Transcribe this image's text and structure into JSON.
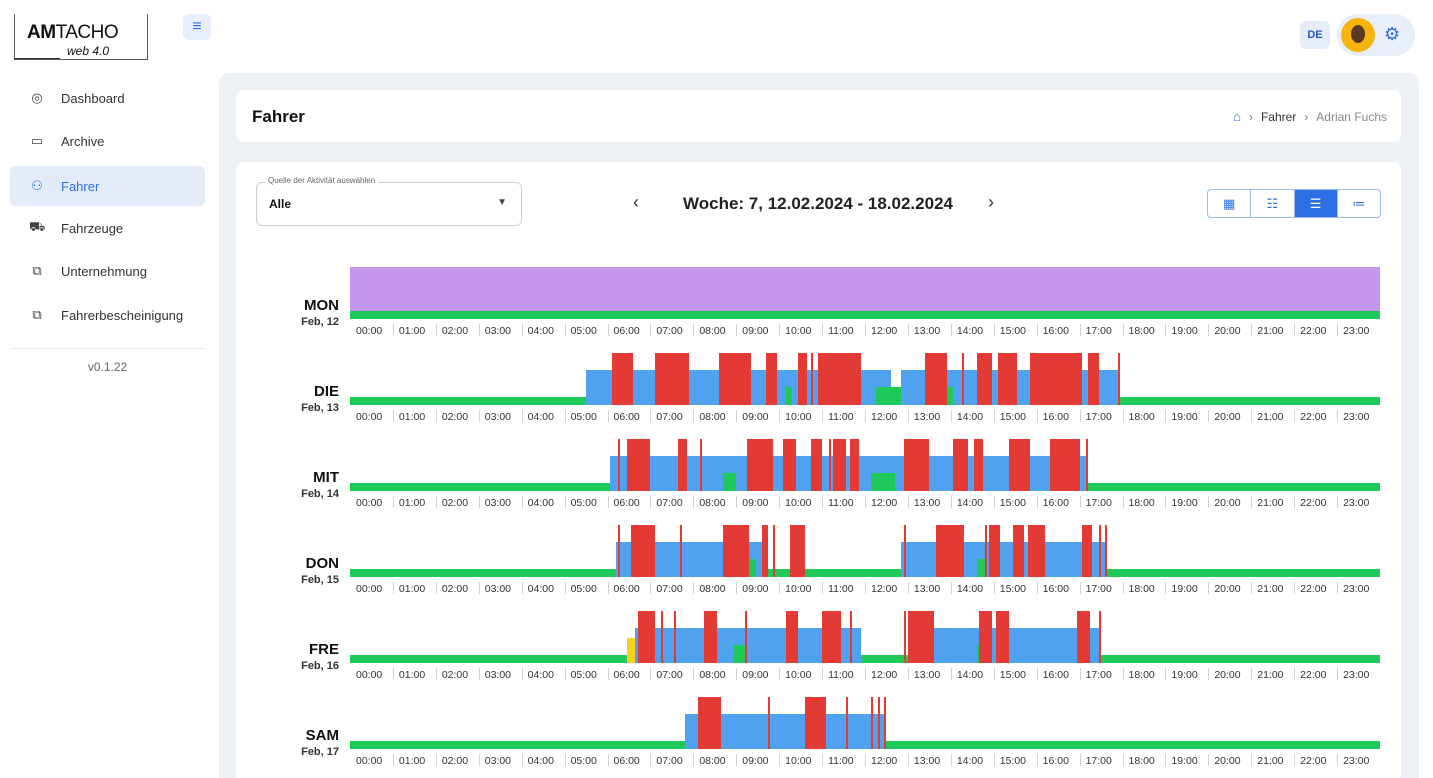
{
  "app": {
    "logo_am": "AM",
    "logo_tacho": "TACHO",
    "logo_sub": "web 4.0",
    "language": "DE"
  },
  "sidebar": {
    "items": [
      {
        "label": "Dashboard",
        "icon": "dashboard-icon"
      },
      {
        "label": "Archive",
        "icon": "archive-icon"
      },
      {
        "label": "Fahrer",
        "icon": "users-icon",
        "active": true
      },
      {
        "label": "Fahrzeuge",
        "icon": "truck-icon"
      },
      {
        "label": "Unternehmung",
        "icon": "building-icon"
      },
      {
        "label": "Fahrerbescheinigung",
        "icon": "certificate-icon"
      }
    ],
    "version": "v0.1.22"
  },
  "header": {
    "title": "Fahrer",
    "breadcrumb": {
      "item1": "Fahrer",
      "item2": "Adrian Fuchs"
    }
  },
  "filter": {
    "label": "Quelle der Aktivität auswählen",
    "value": "Alle"
  },
  "week": {
    "label": "Woche: 7, 12.02.2024 - 18.02.2024"
  },
  "colors": {
    "rest": "#1ec95a",
    "available": "#4fa3ee",
    "work": "#4fa3ee",
    "drive": "#e43a35",
    "unknown": "#c696ef",
    "ferry": "#f4d21c",
    "accent": "#2f6fe4"
  },
  "hours": [
    "00:00",
    "01:00",
    "02:00",
    "03:00",
    "04:00",
    "05:00",
    "06:00",
    "07:00",
    "08:00",
    "09:00",
    "10:00",
    "11:00",
    "12:00",
    "13:00",
    "14:00",
    "15:00",
    "16:00",
    "17:00",
    "18:00",
    "19:00",
    "20:00",
    "21:00",
    "22:00",
    "23:00"
  ],
  "days": [
    {
      "name": "MON",
      "date": "Feb, 12",
      "unknown": [
        0,
        24
      ]
    },
    {
      "name": "DIE",
      "date": "Feb, 13",
      "work": [
        [
          5.5,
          12.6
        ],
        [
          12.85,
          17.95
        ]
      ],
      "rest_gaps": [
        [
          10.15,
          10.3
        ],
        [
          12.25,
          12.85
        ],
        [
          13.5,
          14.05
        ]
      ],
      "drive": [
        [
          6.1,
          6.6
        ],
        [
          7.1,
          7.9
        ],
        [
          8.6,
          9.35
        ],
        [
          9.7,
          9.95
        ],
        [
          10.45,
          10.65
        ],
        [
          10.9,
          11.9
        ],
        [
          13.4,
          13.9
        ],
        [
          14.6,
          14.95
        ],
        [
          15.1,
          15.55
        ],
        [
          15.85,
          17.05
        ],
        [
          17.2,
          17.45
        ]
      ],
      "thin": [
        [
          9.2
        ],
        [
          10.75
        ],
        [
          14.25
        ],
        [
          17.9
        ]
      ]
    },
    {
      "name": "MIT",
      "date": "Feb, 14",
      "work": [
        [
          6.05,
          17.2
        ]
      ],
      "rest_gaps": [
        [
          8.7,
          9.0
        ],
        [
          12.15,
          12.7
        ]
      ],
      "drive": [
        [
          6.45,
          7.0
        ],
        [
          7.65,
          7.85
        ],
        [
          9.25,
          9.85
        ],
        [
          10.1,
          10.4
        ],
        [
          10.75,
          11.0
        ],
        [
          11.25,
          11.55
        ],
        [
          11.65,
          11.85
        ],
        [
          12.9,
          13.5
        ],
        [
          14.05,
          14.4
        ],
        [
          14.55,
          14.75
        ],
        [
          15.35,
          15.85
        ],
        [
          16.3,
          17.0
        ]
      ],
      "thin": [
        [
          6.25
        ],
        [
          8.15
        ],
        [
          11.15
        ],
        [
          17.15
        ]
      ]
    },
    {
      "name": "DON",
      "date": "Feb, 15",
      "work": [
        [
          6.2,
          9.65
        ],
        [
          12.85,
          17.6
        ]
      ],
      "rest_gaps": [
        [
          9.0,
          9.45
        ],
        [
          14.6,
          14.8
        ]
      ],
      "drive": [
        [
          6.55,
          7.1
        ],
        [
          8.7,
          9.3
        ],
        [
          9.6,
          9.75
        ],
        [
          10.25,
          10.6
        ],
        [
          13.65,
          14.3
        ],
        [
          14.9,
          15.15
        ],
        [
          15.45,
          15.7
        ],
        [
          15.8,
          16.2
        ],
        [
          17.05,
          17.3
        ]
      ],
      "thin": [
        [
          6.25
        ],
        [
          7.7
        ],
        [
          9.85
        ],
        [
          12.9
        ],
        [
          14.8
        ],
        [
          17.45
        ],
        [
          17.6
        ]
      ]
    },
    {
      "name": "FRE",
      "date": "Feb, 16",
      "work": [
        [
          6.65,
          11.9
        ],
        [
          13.0,
          17.5
        ]
      ],
      "rest_gaps": [
        [
          8.95,
          9.25
        ],
        [
          14.6,
          14.95
        ]
      ],
      "ferry": [
        [
          6.45,
          6.65
        ]
      ],
      "drive": [
        [
          6.75,
          7.1
        ],
        [
          8.25,
          8.55
        ],
        [
          10.15,
          10.45
        ],
        [
          11.0,
          11.45
        ],
        [
          13.0,
          13.6
        ],
        [
          14.65,
          14.95
        ],
        [
          15.05,
          15.35
        ],
        [
          16.95,
          17.25
        ]
      ],
      "thin": [
        [
          6.7
        ],
        [
          7.25
        ],
        [
          7.55
        ],
        [
          9.2
        ],
        [
          11.65
        ],
        [
          12.9
        ],
        [
          17.45
        ]
      ]
    },
    {
      "name": "SAM",
      "date": "Feb, 17",
      "work": [
        [
          7.8,
          12.5
        ]
      ],
      "rest_gaps": [],
      "drive": [
        [
          8.1,
          8.65
        ],
        [
          10.6,
          11.1
        ]
      ],
      "thin": [
        [
          9.75
        ],
        [
          11.55
        ],
        [
          12.15
        ],
        [
          12.3
        ],
        [
          12.45
        ]
      ]
    }
  ]
}
